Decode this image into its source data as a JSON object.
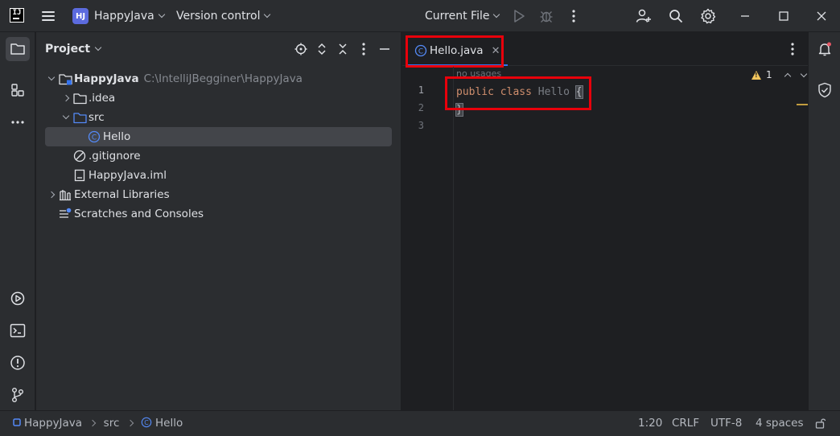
{
  "app": {
    "logo_text": "IJ",
    "project_badge": "HJ",
    "project_name": "HappyJava",
    "vcs_label": "Version control",
    "run_config": "Current File"
  },
  "project_panel": {
    "title": "Project",
    "tree": [
      {
        "label": "HappyJava",
        "hint": "C:\\IntelliJBegginer\\HappyJava",
        "icon": "module-folder-icon",
        "expanded": true
      },
      {
        "label": ".idea",
        "icon": "folder-icon",
        "expanded": false
      },
      {
        "label": "src",
        "icon": "source-folder-icon",
        "expanded": true
      },
      {
        "label": "Hello",
        "icon": "java-class-icon",
        "selected": true
      },
      {
        "label": ".gitignore",
        "icon": "ignore-file-icon"
      },
      {
        "label": "HappyJava.iml",
        "icon": "iml-file-icon"
      },
      {
        "label": "External Libraries",
        "icon": "library-icon",
        "expanded": false
      },
      {
        "label": "Scratches and Consoles",
        "icon": "scratches-icon"
      }
    ]
  },
  "editor": {
    "tab_label": "Hello.java",
    "usages_hint": "no usages",
    "line_numbers": [
      "1",
      "2",
      "3"
    ],
    "code": {
      "kw_public": "public",
      "kw_class": "class",
      "class_name": "Hello",
      "open_brace": "{",
      "close_brace": "}"
    },
    "warnings_count": "1"
  },
  "statusbar": {
    "breadcrumbs": [
      "HappyJava",
      "src",
      "Hello"
    ],
    "caret": "1:20",
    "line_sep": "CRLF",
    "encoding": "UTF-8",
    "indent": "4 spaces"
  },
  "colors": {
    "accent": "#3574f0",
    "highlight_box": "#e8000b",
    "keyword": "#cf8e6d",
    "warning": "#f2c55c"
  }
}
